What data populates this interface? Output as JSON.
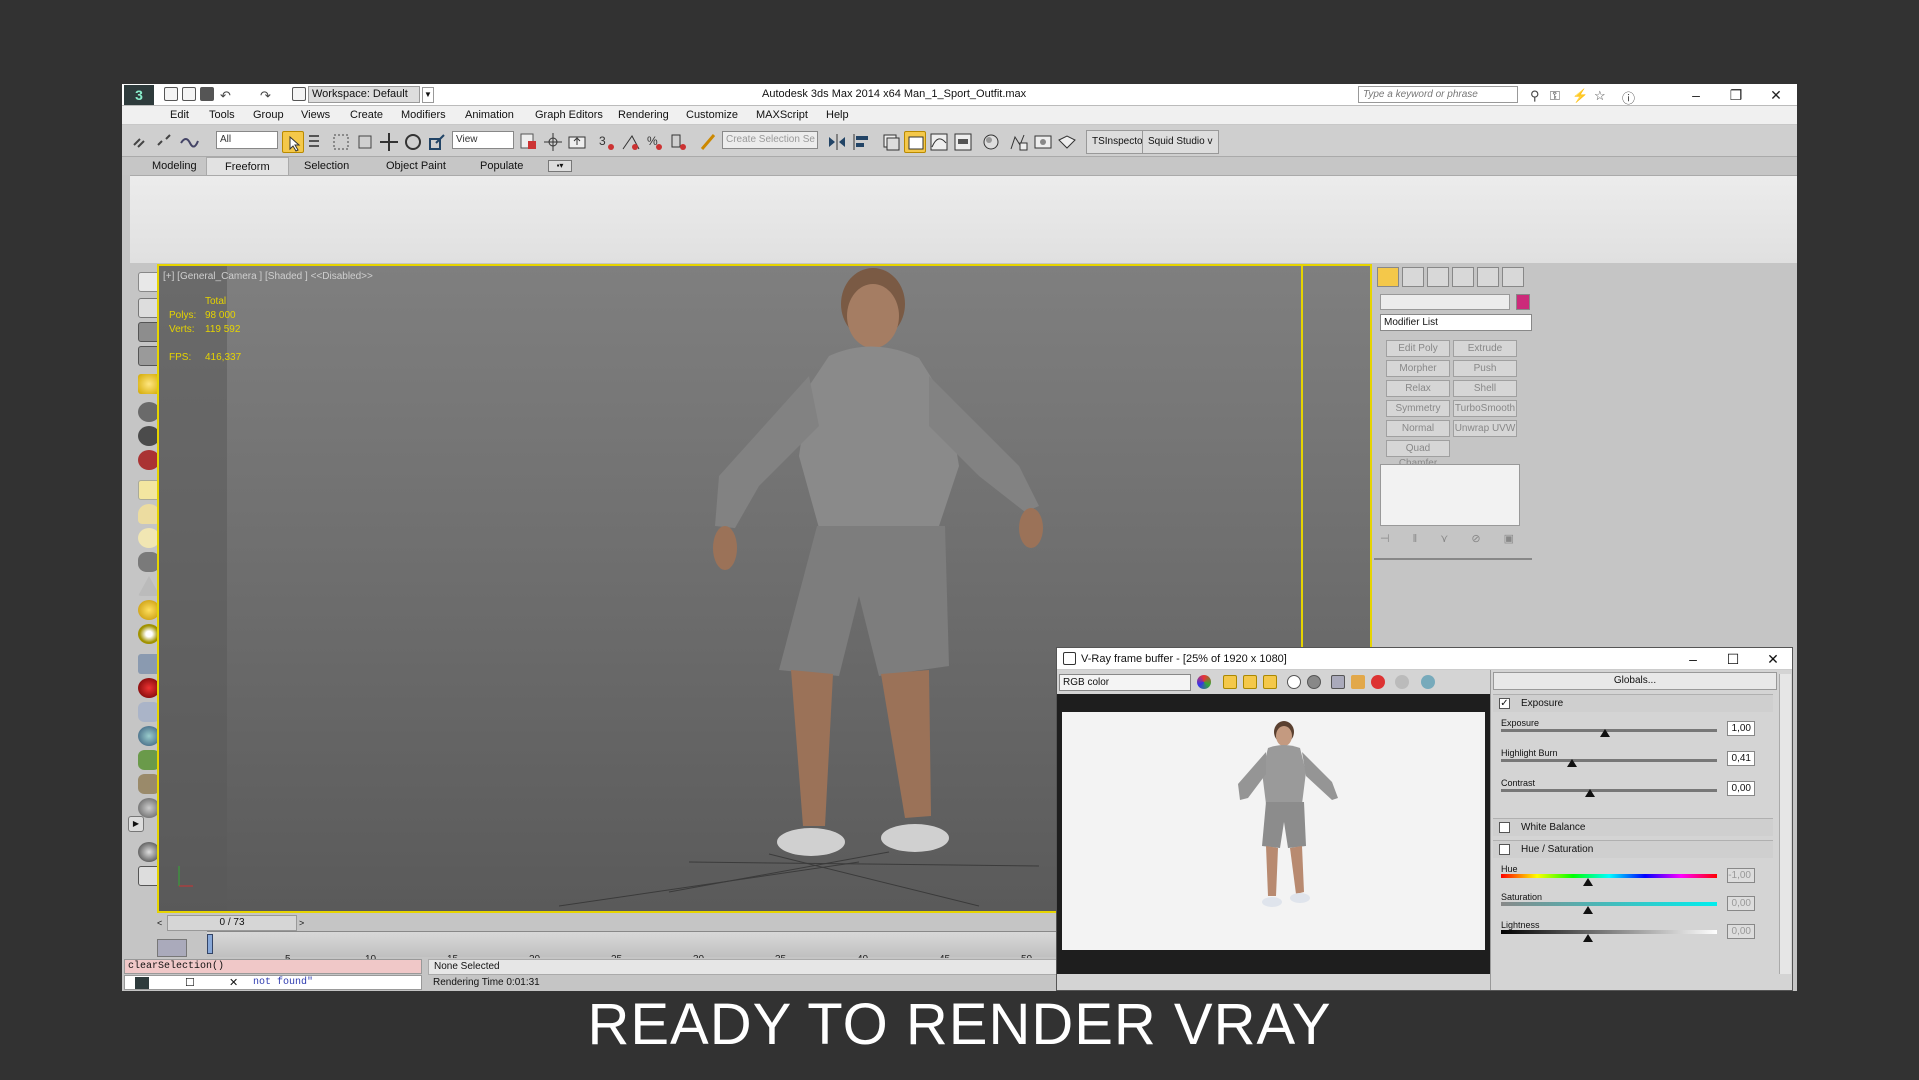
{
  "window": {
    "title": "Autodesk 3ds Max  2014 x64    Man_1_Sport_Outfit.max",
    "workspace": "Workspace: Default",
    "search_placeholder": "Type a keyword or phrase"
  },
  "menu": [
    "Edit",
    "Tools",
    "Group",
    "Views",
    "Create",
    "Modifiers",
    "Animation",
    "Graph Editors",
    "Rendering",
    "Customize",
    "MAXScript",
    "Help"
  ],
  "toolbar": {
    "selection_filter": "All",
    "ref_coord": "View",
    "create_selection_set": "Create Selection Se",
    "plugin1": "TSInspector",
    "plugin2": "Squid Studio v"
  },
  "ribbon_tabs": [
    "Modeling",
    "Freeform",
    "Selection",
    "Object Paint",
    "Populate"
  ],
  "ribbon_active": "Freeform",
  "viewport": {
    "label": "[+] [General_Camera ] [Shaded ]  <<Disabled>>",
    "stats_total": "Total",
    "polys_label": "Polys:",
    "polys_value": "98 000",
    "verts_label": "Verts:",
    "verts_value": "119 592",
    "fps_label": "FPS:",
    "fps_value": "416,337"
  },
  "command_panel": {
    "modifier_list": "Modifier List",
    "buttons": [
      "Edit Poly",
      "Extrude",
      "Morpher",
      "Push",
      "Relax",
      "Shell",
      "Symmetry",
      "TurboSmooth",
      "Normal",
      "Unwrap UVW",
      "Quad Chamfer"
    ],
    "color_swatch": "#cc2a7a"
  },
  "timeline": {
    "frame": "0 / 73",
    "ticks": [
      "5",
      "10",
      "15",
      "20",
      "25",
      "30",
      "35",
      "40",
      "45",
      "50"
    ]
  },
  "status": {
    "maxscript_line1": "clearSelection()",
    "maxscript_line2": "not found\"",
    "selection": "None Selected",
    "render_time": "Rendering Time  0:01:31"
  },
  "vfb": {
    "title": "V-Ray frame buffer - [25% of 1920 x 1080]",
    "channel": "RGB color",
    "globals": "Globals...",
    "exposure_section": "Exposure",
    "exposure_label": "Exposure",
    "exposure_value": "1,00",
    "exposure_fraction": 0.48,
    "highlight_label": "Highlight Burn",
    "highlight_value": "0,41",
    "highlight_fraction": 0.33,
    "contrast_label": "Contrast",
    "contrast_value": "0,00",
    "contrast_fraction": 0.41,
    "white_balance": "White Balance",
    "hue_saturation": "Hue / Saturation",
    "hue_label": "Hue",
    "hue_value": "-1,00",
    "saturation_label": "Saturation",
    "saturation_value": "0,00",
    "lightness_label": "Lightness",
    "lightness_value": "0,00"
  },
  "caption": "READY TO RENDER VRAY"
}
